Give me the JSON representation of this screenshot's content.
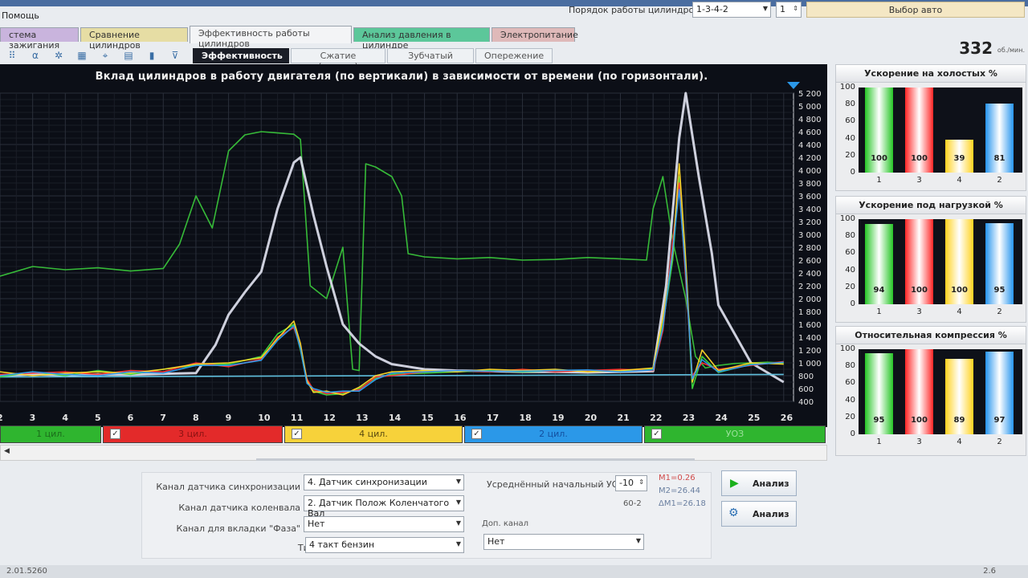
{
  "menu": {
    "help": "Помощь"
  },
  "header": {
    "cyl_order_label": "Порядок работы цилиндров",
    "cyl_order_value": "1-3-4-2",
    "cyl_number": "1",
    "vehicle_button": "Выбор авто",
    "rpm": "332",
    "rpm_unit": "об./мин."
  },
  "tabs": [
    {
      "label": "стема зажигания",
      "color": "#c9b4dd"
    },
    {
      "label": "Сравнение цилиндров",
      "color": "#e6dda4"
    },
    {
      "label": "Эффективность работы цилиндров",
      "color": "#f3f4f6"
    },
    {
      "label": "Анализ давления в цилиндре",
      "color": "#5cc79a"
    },
    {
      "label": "Электропитание",
      "color": "#dfb9b9"
    }
  ],
  "subtabs": [
    "Эффективность",
    "Сжатие (дизель)",
    "Зубчатый диск",
    "Опережение"
  ],
  "toolbar_icons": [
    "wave-icon",
    "alg-icon",
    "snowflake-icon",
    "cylinders-icon",
    "marker-icon",
    "table-icon",
    "bar-chart-icon",
    "filter-icon"
  ],
  "chart_data": {
    "type": "line",
    "title": "Вклад цилиндров в работу двигателя (по вертикали) в зависимости от времени (по горизонтали).",
    "x_ticks": [
      "2",
      "3",
      "4",
      "5",
      "6",
      "7",
      "8",
      "9",
      "10",
      "11",
      "12",
      "13",
      "14",
      "15",
      "16",
      "17",
      "18",
      "19",
      "20",
      "21",
      "22",
      "23",
      "24",
      "25",
      "26"
    ],
    "y_ticks": [
      "400",
      "600",
      "800",
      "1 000",
      "1 200",
      "1 400",
      "1 600",
      "1 800",
      "2 000",
      "2 200",
      "2 400",
      "2 600",
      "2 800",
      "3 000",
      "3 200",
      "3 400",
      "3 600",
      "3 800",
      "4 000",
      "4 200",
      "4 400",
      "4 600",
      "4 800",
      "5 000",
      "5 200"
    ],
    "ylim": [
      400,
      5200
    ],
    "xlim": [
      2,
      26.3
    ],
    "series": [
      {
        "name": "УОЗ",
        "color": "#39c43a",
        "x": [
          2,
          3,
          4,
          5,
          6,
          7,
          7.5,
          8,
          8.5,
          9,
          9.5,
          10,
          10.5,
          11,
          11.2,
          11.5,
          12,
          12.5,
          12.8,
          13,
          13.2,
          13.5,
          14,
          14.3,
          14.5,
          15,
          16,
          17,
          18,
          19,
          20,
          21,
          21.8,
          22,
          22.3,
          22.6,
          23,
          23.3,
          23.6,
          24,
          24.5,
          25,
          25.5,
          26
        ],
        "y": [
          2350,
          2500,
          2450,
          2480,
          2430,
          2470,
          2850,
          3600,
          3100,
          4300,
          4550,
          4600,
          4580,
          4560,
          4480,
          2200,
          2000,
          2800,
          900,
          880,
          4100,
          4050,
          3900,
          3600,
          2700,
          2650,
          2620,
          2640,
          2600,
          2610,
          2640,
          2620,
          2600,
          3400,
          3900,
          2900,
          2000,
          1100,
          920,
          960,
          990,
          1000,
          1010,
          1000
        ]
      },
      {
        "name": "",
        "color": "#d9dbe8",
        "x": [
          2,
          3,
          4,
          5,
          6,
          7,
          8,
          8.6,
          9,
          9.5,
          10,
          10.5,
          11,
          11.2,
          11.6,
          12,
          12.5,
          13,
          13.5,
          14,
          15,
          16,
          17,
          18,
          19,
          20,
          21,
          22,
          22.4,
          22.8,
          23,
          23.4,
          23.8,
          24,
          25,
          26
        ],
        "y": [
          800,
          820,
          810,
          820,
          815,
          830,
          840,
          1280,
          1750,
          2100,
          2420,
          3400,
          4120,
          4200,
          3300,
          2500,
          1600,
          1300,
          1100,
          980,
          900,
          880,
          870,
          860,
          860,
          850,
          860,
          870,
          2200,
          4500,
          5200,
          3900,
          2700,
          1900,
          1000,
          700
        ]
      },
      {
        "name": "",
        "color": "#63c7e6",
        "x": [
          2,
          26
        ],
        "y": [
          780,
          820
        ]
      },
      {
        "name": "1 цил.",
        "color": "#3cd93c",
        "x": [
          2,
          3,
          4,
          5,
          6,
          7,
          8,
          9,
          10,
          10.5,
          11,
          11.2,
          11.4,
          11.6,
          12,
          12.5,
          13,
          13.5,
          14,
          15,
          16,
          17,
          18,
          19,
          20,
          21,
          22,
          22.3,
          22.6,
          22.8,
          23,
          23.2,
          23.5,
          24,
          25,
          26
        ],
        "y": [
          780,
          860,
          800,
          880,
          820,
          900,
          960,
          980,
          1100,
          1450,
          1600,
          1200,
          700,
          560,
          500,
          520,
          600,
          760,
          820,
          840,
          860,
          880,
          860,
          880,
          870,
          880,
          900,
          1600,
          2600,
          3900,
          2500,
          600,
          1100,
          850,
          980,
          1000
        ]
      },
      {
        "name": "3 цил.",
        "color": "#ff3030",
        "x": [
          2,
          3,
          4,
          5,
          6,
          7,
          8,
          9,
          10,
          10.5,
          11,
          11.2,
          11.4,
          11.6,
          12,
          12.5,
          13,
          13.5,
          14,
          15,
          16,
          17,
          18,
          19,
          20,
          21,
          22,
          22.3,
          22.6,
          22.8,
          23,
          23.2,
          23.5,
          24,
          25,
          26
        ],
        "y": [
          820,
          840,
          860,
          820,
          880,
          860,
          1000,
          940,
          1060,
          1400,
          1550,
          1250,
          750,
          580,
          520,
          540,
          580,
          780,
          800,
          860,
          880,
          860,
          900,
          860,
          880,
          900,
          880,
          1500,
          2900,
          3800,
          2300,
          800,
          1000,
          900,
          960,
          1020
        ]
      },
      {
        "name": "4 цил.",
        "color": "#ffd92a",
        "x": [
          2,
          3,
          4,
          5,
          6,
          7,
          8,
          9,
          10,
          10.5,
          11,
          11.2,
          11.4,
          11.6,
          12,
          12.5,
          13,
          13.5,
          14,
          15,
          16,
          17,
          18,
          19,
          20,
          21,
          22,
          22.3,
          22.6,
          22.8,
          23,
          23.2,
          23.5,
          24,
          25,
          26
        ],
        "y": [
          860,
          800,
          840,
          860,
          840,
          900,
          980,
          1000,
          1080,
          1380,
          1650,
          1300,
          720,
          540,
          560,
          500,
          620,
          800,
          860,
          880,
          860,
          900,
          880,
          900,
          860,
          880,
          920,
          1700,
          2700,
          4100,
          2600,
          700,
          1200,
          880,
          1000,
          980
        ]
      },
      {
        "name": "2 цил.",
        "color": "#2f9df0",
        "x": [
          2,
          3,
          4,
          5,
          6,
          7,
          8,
          9,
          10,
          10.5,
          11,
          11.2,
          11.4,
          11.6,
          12,
          12.5,
          13,
          13.5,
          14,
          15,
          16,
          17,
          18,
          19,
          20,
          21,
          22,
          22.3,
          22.6,
          22.8,
          23,
          23.2,
          23.5,
          24,
          25,
          26
        ],
        "y": [
          800,
          860,
          820,
          800,
          860,
          840,
          960,
          960,
          1040,
          1350,
          1580,
          1220,
          680,
          600,
          540,
          560,
          560,
          740,
          840,
          860,
          880,
          870,
          870,
          880,
          890,
          860,
          890,
          1550,
          2750,
          3700,
          2400,
          750,
          1050,
          860,
          970,
          1010
        ]
      }
    ]
  },
  "legend": [
    {
      "label": "1 цил.",
      "color": "#2fb52f",
      "text": "#1b6d1b",
      "checked": false
    },
    {
      "label": "3 цил.",
      "color": "#e32a2a",
      "text": "#8a1212",
      "checked": true
    },
    {
      "label": "4 цил.",
      "color": "#f7d23a",
      "text": "#5a4a10",
      "checked": true
    },
    {
      "label": "2 цил.",
      "color": "#2b98e8",
      "text": "#1350a0",
      "checked": true
    },
    {
      "label": "УОЗ",
      "color": "#2fb52f",
      "text": "#9be09b",
      "checked": true
    }
  ],
  "panels": [
    {
      "title": "Ускорение на холостых %",
      "yticks": [
        "100",
        "80",
        "60",
        "40",
        "20",
        "0"
      ],
      "labels": [
        "1",
        "3",
        "4",
        "2"
      ],
      "values": [
        100,
        100,
        39,
        81
      ]
    },
    {
      "title": "Ускорение под нагрузкой %",
      "yticks": [
        "100",
        "80",
        "60",
        "40",
        "20",
        "0"
      ],
      "labels": [
        "1",
        "3",
        "4",
        "2"
      ],
      "values": [
        94,
        100,
        100,
        95
      ]
    },
    {
      "title": "Относительная компрессия %",
      "yticks": [
        "100",
        "80",
        "60",
        "40",
        "20",
        "0"
      ],
      "labels": [
        "1",
        "3",
        "4",
        "2"
      ],
      "values": [
        95,
        100,
        89,
        97
      ]
    }
  ],
  "bar_colors": [
    "#25c525",
    "#ff2626",
    "#ffd21e",
    "#2594ee"
  ],
  "form": {
    "sync_label": "Канал датчика синхронизации",
    "sync_value": "4. Датчик синхронизации",
    "crank_label": "Канал датчика коленвала",
    "crank_value": "2. Датчик Полож Коленчатого Вал",
    "phase_label": "Канал для вкладки \"Фаза\"",
    "phase_value": "Нет",
    "engine_label": "Тип двигателя",
    "engine_value": "4 такт бензин",
    "uoz_label": "Усреднённый начальный УОЗ",
    "uoz_value": "-10",
    "teeth_value": "60-2",
    "extra_label": "Доп. канал",
    "extra_value": "Нет",
    "m1": "M1=0.26",
    "m2": "M2=26.44",
    "dm": "ΔM1=26.18",
    "analyze1": "Анализ",
    "analyze2": "Анализ"
  },
  "status": {
    "version": "2.01.5260",
    "right": "2.6"
  }
}
